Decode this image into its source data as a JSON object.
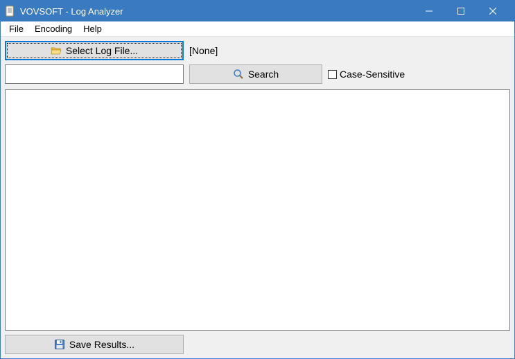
{
  "window": {
    "title": "VOVSOFT - Log Analyzer"
  },
  "menu": {
    "file": "File",
    "encoding": "Encoding",
    "help": "Help"
  },
  "buttons": {
    "select_log_file": "Select Log File...",
    "search": "Search",
    "save_results": "Save Results..."
  },
  "labels": {
    "selected_file": "[None]",
    "case_sensitive": "Case-Sensitive"
  },
  "inputs": {
    "search_value": ""
  },
  "state": {
    "case_sensitive_checked": false
  }
}
